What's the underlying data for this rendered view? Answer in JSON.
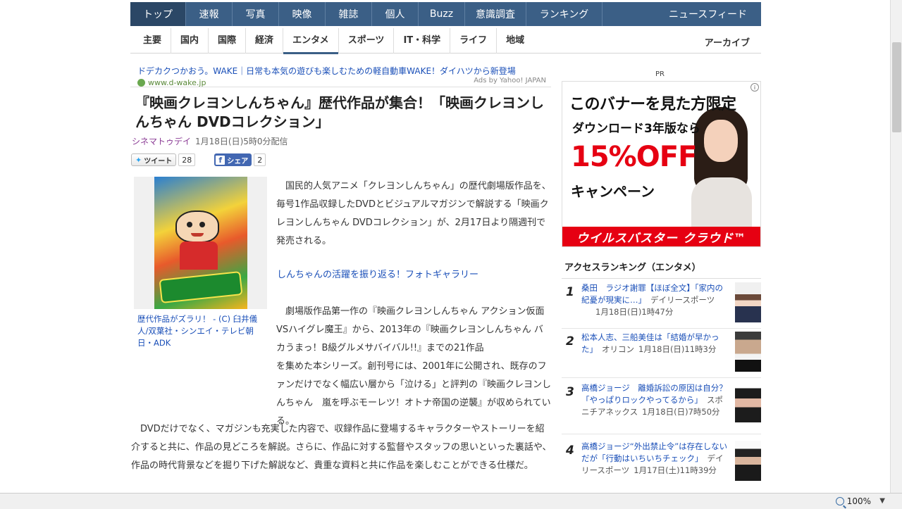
{
  "global_nav": {
    "items": [
      {
        "label": "トップ",
        "width": 79,
        "active": true
      },
      {
        "label": "速報",
        "width": 66
      },
      {
        "label": "写真",
        "width": 66
      },
      {
        "label": "映像",
        "width": 66
      },
      {
        "label": "雑誌",
        "width": 66
      },
      {
        "label": "個人",
        "width": 66
      },
      {
        "label": "Buzz",
        "width": 66
      },
      {
        "label": "意識調査",
        "width": 87
      },
      {
        "label": "ランキング",
        "width": 108
      }
    ],
    "feed_label": "ニュースフィード"
  },
  "sub_nav": {
    "items": [
      "主要",
      "国内",
      "国際",
      "経済",
      "エンタメ",
      "スポーツ",
      "IT・科学",
      "ライフ",
      "地域"
    ],
    "active_index": 4,
    "archive_label": "アーカイブ"
  },
  "ad": {
    "text": "ドデカクつかおう。WAKE｜日常も本気の遊びも楽しむための軽自動車WAKE！ダイハツから新登場",
    "domain": "www.d-wake.jp",
    "label": "Ads by Yahoo! JAPAN"
  },
  "article": {
    "title": "『映画クレヨンしんちゃん』歴代作品が集合！「映画クレヨンしんちゃん DVDコレクション」",
    "source": "シネマトゥデイ",
    "date": "1月18日(日)5時0分配信",
    "tweet_label": "ツイート",
    "tweet_count": "28",
    "share_label": "シェア",
    "share_count": "2",
    "photo_caption": "歴代作品がズラリ！ - (C) 臼井儀人/双葉社・シンエイ・テレビ朝日・ADK",
    "para1": "国民的人気アニメ「クレヨンしんちゃん」の歴代劇場版作品を、毎号1作品収録したDVDとビジュアルマガジンで解説する「映画クレヨンしんちゃん DVDコレクション」が、2月17日より隔週刊で発売される。",
    "gallery_link": "しんちゃんの活躍を振り返る！フォトギャラリー",
    "para2": "劇場版作品第一作の『映画クレヨンしんちゃん アクション仮面VSハイグレ魔王』から、2013年の『映画クレヨンしんちゃん バカうまっ！B級グルメサバイバル!!』までの21作品",
    "para3": "を集めた本シリーズ。創刊号には、2001年に公開され、既存のファンだけでなく幅広い層から「泣ける」と評判の『映画クレヨンしんちゃん　嵐を呼ぶモーレツ！オトナ帝国の逆襲』が収められている。",
    "para4": "DVDだけでなく、マガジンも充実した内容で、収録作品に登場するキャラクターやストーリーを紹介すると共に、作品の見どころを解説。さらに、作品に対する監督やスタッフの思いといった裏話や、作品の時代背景などを掘り下げた解説など、貴重な資料と共に作品を楽しむことができる仕様だ。"
  },
  "sidebar": {
    "pr_label": "PR",
    "banner": {
      "line1": "このバナーを見た方限定",
      "line2": "ダウンロード3年版なら",
      "line3": "15%OFF",
      "line4": "キャンペーン",
      "footer": "ウイルスバスター クラウド™"
    },
    "ranking_title": "アクセスランキング（エンタメ）",
    "ranking": [
      {
        "rank": "1",
        "title": "桑田　ラジオ謝罪【ほぼ全文】「家内の紀憂が現実に…」",
        "source": "デイリースポーツ",
        "date": "1月18日(日)1時47分"
      },
      {
        "rank": "2",
        "title": "松本人志、三船美佳は「結婚が早かった」",
        "source": "オリコン",
        "date": "1月18日(日)11時3分"
      },
      {
        "rank": "3",
        "title": "高橋ジョージ　離婚訴訟の原因は自分？「やっぱりロックやってるから」",
        "source": "スポニチアネックス",
        "date": "1月18日(日)7時50分"
      },
      {
        "rank": "4",
        "title": "高橋ジョージ“外出禁止令”は存在しない　だが「行動はいちいちチェック」",
        "source": "デイリースポーツ",
        "date": "1月17日(土)11時39分"
      }
    ]
  },
  "statusbar": {
    "zoom": "100%"
  }
}
